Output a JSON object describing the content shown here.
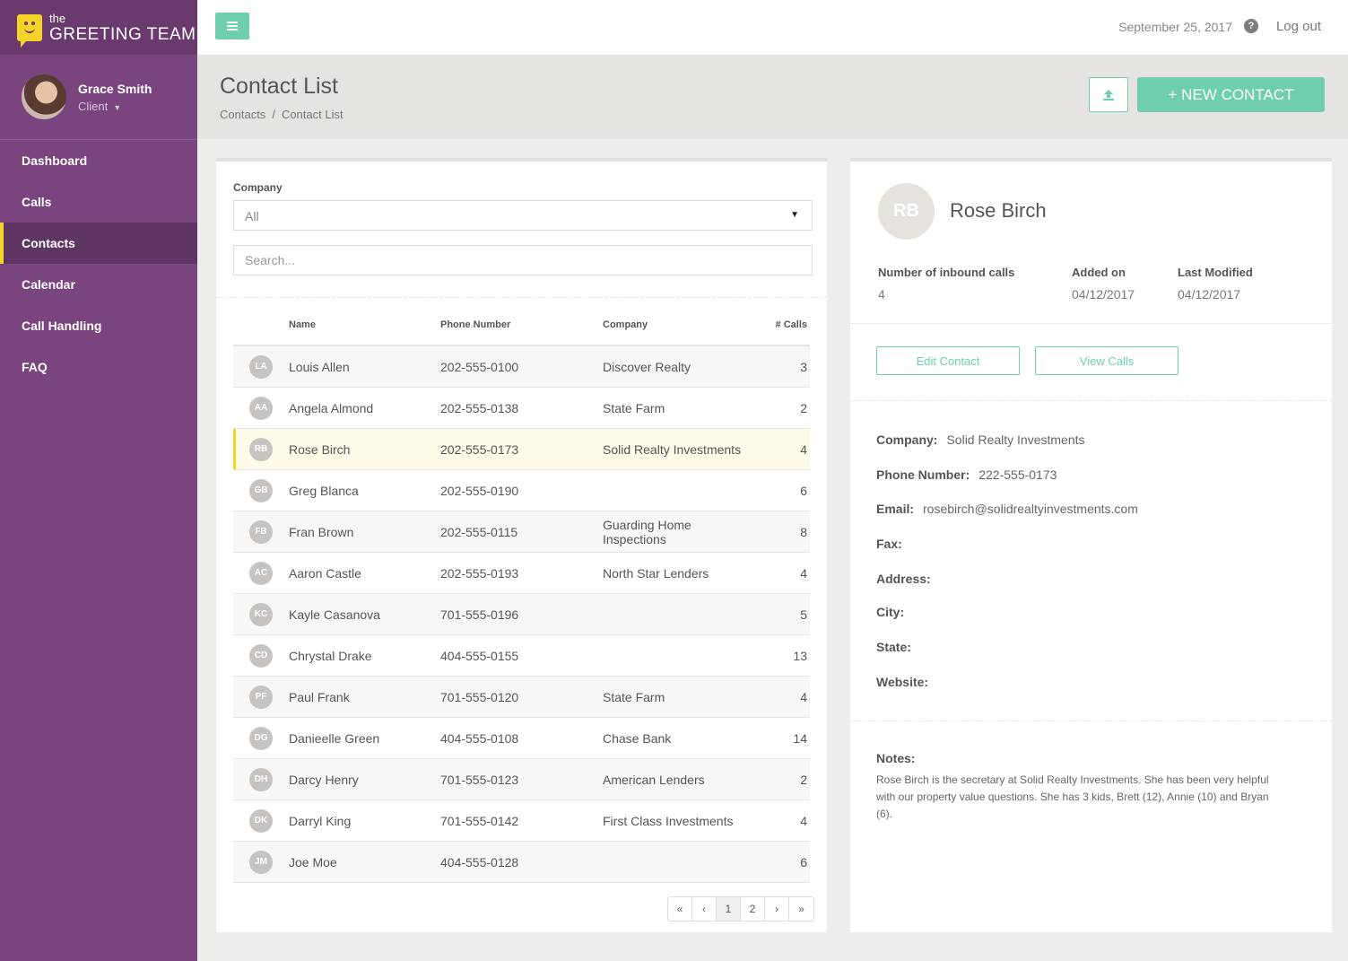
{
  "brand": {
    "line1": "the",
    "line2": "GREETING TEAM"
  },
  "user": {
    "name": "Grace Smith",
    "role": "Client"
  },
  "nav": [
    {
      "label": "Dashboard",
      "active": false
    },
    {
      "label": "Calls",
      "active": false
    },
    {
      "label": "Contacts",
      "active": true
    },
    {
      "label": "Calendar",
      "active": false
    },
    {
      "label": "Call Handling",
      "active": false
    },
    {
      "label": "FAQ",
      "active": false
    }
  ],
  "topbar": {
    "date": "September 25, 2017",
    "help": "?",
    "logout": "Log out"
  },
  "header": {
    "title": "Contact List",
    "breadcrumb": [
      "Contacts",
      "Contact List"
    ],
    "new_contact": "+ NEW CONTACT"
  },
  "filter": {
    "label": "Company",
    "selected": "All",
    "search_placeholder": "Search..."
  },
  "table": {
    "headers": {
      "name": "Name",
      "phone": "Phone Number",
      "company": "Company",
      "calls": "# Calls"
    },
    "rows": [
      {
        "initials": "LA",
        "name": "Louis Allen",
        "phone": "202-555-0100",
        "company": "Discover Realty",
        "calls": "3"
      },
      {
        "initials": "AA",
        "name": "Angela Almond",
        "phone": "202-555-0138",
        "company": "State Farm",
        "calls": "2"
      },
      {
        "initials": "RB",
        "name": "Rose Birch",
        "phone": "202-555-0173",
        "company": "Solid Realty Investments",
        "calls": "4",
        "selected": true
      },
      {
        "initials": "GB",
        "name": "Greg Blanca",
        "phone": "202-555-0190",
        "company": "",
        "calls": "6"
      },
      {
        "initials": "FB",
        "name": "Fran Brown",
        "phone": "202-555-0115",
        "company": "Guarding Home Inspections",
        "calls": "8"
      },
      {
        "initials": "AC",
        "name": "Aaron Castle",
        "phone": "202-555-0193",
        "company": "North Star Lenders",
        "calls": "4"
      },
      {
        "initials": "KC",
        "name": "Kayle Casanova",
        "phone": "701-555-0196",
        "company": "",
        "calls": "5"
      },
      {
        "initials": "CD",
        "name": "Chrystal Drake",
        "phone": "404-555-0155",
        "company": "",
        "calls": "13"
      },
      {
        "initials": "PF",
        "name": "Paul Frank",
        "phone": "701-555-0120",
        "company": "State Farm",
        "calls": "4"
      },
      {
        "initials": "DG",
        "name": "Danieelle Green",
        "phone": "404-555-0108",
        "company": "Chase Bank",
        "calls": "14"
      },
      {
        "initials": "DH",
        "name": "Darcy Henry",
        "phone": "701-555-0123",
        "company": "American Lenders",
        "calls": "2"
      },
      {
        "initials": "DK",
        "name": "Darryl King",
        "phone": "701-555-0142",
        "company": "First Class Investments",
        "calls": "4"
      },
      {
        "initials": "JM",
        "name": "Joe Moe",
        "phone": "404-555-0128",
        "company": "",
        "calls": "6"
      }
    ]
  },
  "pagination": {
    "first": "«",
    "prev": "‹",
    "pages": [
      "1",
      "2"
    ],
    "current": "1",
    "next": "›",
    "last": "»"
  },
  "detail": {
    "initials": "RB",
    "name": "Rose Birch",
    "stats": [
      {
        "label": "Number of inbound calls",
        "value": "4"
      },
      {
        "label": "Added on",
        "value": "04/12/2017"
      },
      {
        "label": "Last Modified",
        "value": "04/12/2017"
      }
    ],
    "edit_button": "Edit Contact",
    "view_calls_button": "View Calls",
    "fields": [
      {
        "label": "Company:",
        "value": "Solid Realty Investments"
      },
      {
        "label": "Phone Number:",
        "value": "222-555-0173"
      },
      {
        "label": "Email:",
        "value": "rosebirch@solidrealtyinvestments.com"
      },
      {
        "label": "Fax:",
        "value": ""
      },
      {
        "label": "Address:",
        "value": ""
      },
      {
        "label": "City:",
        "value": ""
      },
      {
        "label": "State:",
        "value": ""
      },
      {
        "label": "Website:",
        "value": ""
      }
    ],
    "notes_label": "Notes:",
    "notes": "Rose Birch is the secretary at Solid Realty Investments.  She has been very helpful with our property value questions. She has 3 kids, Brett (12), Annie (10) and Bryan (6)."
  },
  "colors": {
    "sidebar": "#7a457e",
    "accent": "#6fcfac",
    "highlight": "#f5d327"
  }
}
